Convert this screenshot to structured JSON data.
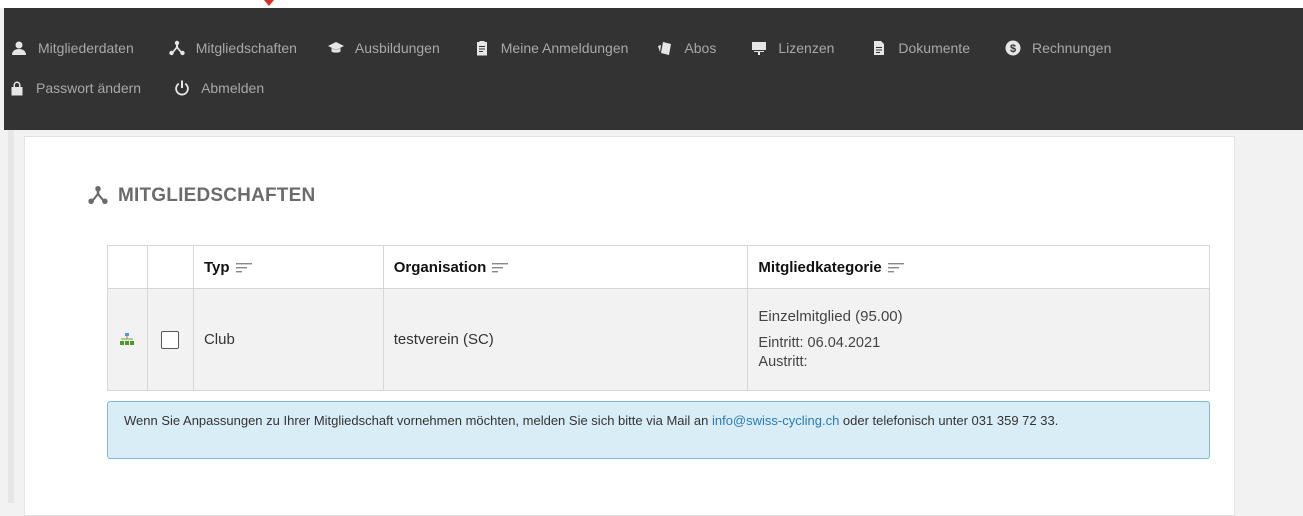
{
  "nav": {
    "row1": [
      {
        "label": "Mitgliederdaten",
        "icon": "user-icon"
      },
      {
        "label": "Mitgliedschaften",
        "icon": "network-icon"
      },
      {
        "label": "Ausbildungen",
        "icon": "graduation-cap-icon"
      },
      {
        "label": "Meine Anmeldungen",
        "icon": "clipboard-icon"
      },
      {
        "label": "Abos",
        "icon": "cards-icon"
      },
      {
        "label": "Lizenzen",
        "icon": "easel-icon"
      },
      {
        "label": "Dokumente",
        "icon": "document-icon"
      },
      {
        "label": "Rechnungen",
        "icon": "dollar-circle-icon"
      }
    ],
    "row2": [
      {
        "label": "Passwort ändern",
        "icon": "lock-icon"
      },
      {
        "label": "Abmelden",
        "icon": "power-icon"
      }
    ]
  },
  "page": {
    "title": "MITGLIEDSCHAFTEN"
  },
  "table": {
    "headers": [
      "",
      "",
      "Typ",
      "Organisation",
      "Mitgliedkategorie"
    ],
    "rows": [
      {
        "typ": "Club",
        "organisation": "testverein (SC)",
        "kategorie": "Einzelmitglied (95.00)",
        "eintritt": "Eintritt: 06.04.2021",
        "austritt": "Austritt:"
      }
    ]
  },
  "info": {
    "text_before": "Wenn Sie Anpassungen zu Ihrer Mitgliedschaft vornehmen möchten, melden Sie sich bitte via Mail an ",
    "email": "info@swiss-cycling.ch",
    "text_after": " oder telefonisch unter 031 359 72 33."
  },
  "colors": {
    "nav_bg": "#333333",
    "info_bg": "#d9edf7",
    "link": "#2a7ab8"
  }
}
